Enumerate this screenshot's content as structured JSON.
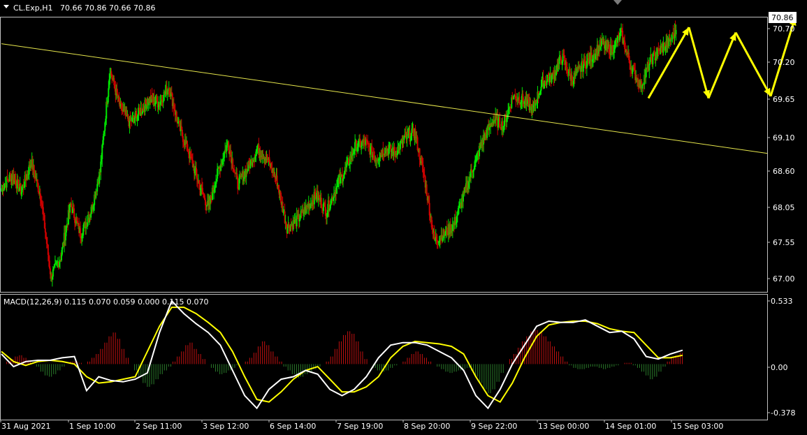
{
  "header": {
    "symbol": "CL.Exp,H1",
    "ohlc": "70.66 70.86 70.66 70.86",
    "current_price": "70.86"
  },
  "macd_header": "MACD(12,26,9) 0.115 0.070 0.059 0.000 0.115 0.070",
  "colors": {
    "background": "#000000",
    "bull": "#00e600",
    "bear": "#d00000",
    "trendline": "#e6e64c",
    "projection": "#ffff00",
    "macd_line": "#ffffff",
    "signal_line": "#ffff00",
    "grid_text": "#ffffff",
    "border": "#c0c0c0"
  },
  "chart_data": [
    {
      "type": "candlestick",
      "title": "CL.Exp,H1",
      "y_ticks": [
        "70.70",
        "70.20",
        "69.65",
        "69.10",
        "68.60",
        "68.05",
        "67.55",
        "67.00"
      ],
      "x_ticks": [
        "31 Aug 2021",
        "1 Sep 10:00",
        "2 Sep 11:00",
        "3 Sep 12:00",
        "6 Sep 14:00",
        "7 Sep 19:00",
        "8 Sep 20:00",
        "9 Sep 22:00",
        "13 Sep 00:00",
        "14 Sep 01:00",
        "15 Sep 03:00"
      ],
      "ylim": [
        66.87,
        71.05
      ],
      "close_path": [
        [
          0,
          68.45
        ],
        [
          1,
          68.65
        ],
        [
          2,
          68.4
        ],
        [
          3,
          68.85
        ],
        [
          4,
          68.3
        ],
        [
          5,
          67.1
        ],
        [
          6,
          67.4
        ],
        [
          7,
          68.2
        ],
        [
          8,
          67.75
        ],
        [
          9,
          68.05
        ],
        [
          10,
          68.7
        ],
        [
          11,
          70.25
        ],
        [
          12,
          69.7
        ],
        [
          13,
          69.45
        ],
        [
          14,
          69.6
        ],
        [
          15,
          69.8
        ],
        [
          16,
          69.75
        ],
        [
          17,
          70.0
        ],
        [
          18,
          69.4
        ],
        [
          19,
          69.0
        ],
        [
          20,
          68.55
        ],
        [
          21,
          68.15
        ],
        [
          22,
          68.7
        ],
        [
          23,
          69.15
        ],
        [
          24,
          68.5
        ],
        [
          25,
          68.75
        ],
        [
          26,
          69.05
        ],
        [
          27,
          68.9
        ],
        [
          28,
          68.55
        ],
        [
          29,
          67.85
        ],
        [
          30,
          67.95
        ],
        [
          31,
          68.15
        ],
        [
          32,
          68.35
        ],
        [
          33,
          68.1
        ],
        [
          34,
          68.45
        ],
        [
          35,
          68.75
        ],
        [
          36,
          69.1
        ],
        [
          37,
          69.15
        ],
        [
          38,
          68.9
        ],
        [
          39,
          69.05
        ],
        [
          40,
          69.0
        ],
        [
          41,
          69.2
        ],
        [
          42,
          69.3
        ],
        [
          43,
          68.6
        ],
        [
          44,
          67.65
        ],
        [
          45,
          67.75
        ],
        [
          46,
          67.9
        ],
        [
          47,
          68.35
        ],
        [
          48,
          68.8
        ],
        [
          49,
          69.2
        ],
        [
          50,
          69.5
        ],
        [
          51,
          69.4
        ],
        [
          52,
          69.85
        ],
        [
          53,
          69.8
        ],
        [
          54,
          69.65
        ],
        [
          55,
          70.05
        ],
        [
          56,
          70.15
        ],
        [
          57,
          70.45
        ],
        [
          58,
          70.1
        ],
        [
          59,
          70.3
        ],
        [
          60,
          70.45
        ],
        [
          61,
          70.65
        ],
        [
          62,
          70.55
        ],
        [
          63,
          70.8
        ],
        [
          64,
          70.3
        ],
        [
          65,
          70.0
        ],
        [
          66,
          70.4
        ],
        [
          67,
          70.55
        ],
        [
          68,
          70.7
        ],
        [
          69,
          70.86
        ]
      ],
      "trendline": [
        [
          0,
          70.65
        ],
        [
          73,
          68.98
        ]
      ],
      "projection": [
        [
          63,
          69.82
        ],
        [
          64,
          70.9
        ],
        [
          65,
          69.82
        ],
        [
          66,
          70.82
        ],
        [
          67,
          69.85
        ],
        [
          68,
          71.05
        ]
      ]
    },
    {
      "type": "macd",
      "title": "MACD(12,26,9)",
      "params": [
        12,
        26,
        9
      ],
      "values": {
        "macd": 0.115,
        "signal": 0.07
      },
      "y_ticks": [
        "0.533",
        "0.00",
        "-0.378"
      ],
      "ylim": [
        -0.44,
        0.55
      ],
      "macd_line": [
        [
          0,
          0.08
        ],
        [
          1,
          -0.02
        ],
        [
          2,
          0.02
        ],
        [
          3,
          0.03
        ],
        [
          4,
          0.03
        ],
        [
          5,
          0.05
        ],
        [
          6,
          0.06
        ],
        [
          7,
          -0.21
        ],
        [
          8,
          -0.1
        ],
        [
          9,
          -0.13
        ],
        [
          10,
          -0.14
        ],
        [
          11,
          -0.12
        ],
        [
          12,
          -0.07
        ],
        [
          13,
          0.25
        ],
        [
          14,
          0.5
        ],
        [
          15,
          0.4
        ],
        [
          16,
          0.32
        ],
        [
          17,
          0.25
        ],
        [
          18,
          0.15
        ],
        [
          19,
          -0.05
        ],
        [
          20,
          -0.25
        ],
        [
          21,
          -0.35
        ],
        [
          22,
          -0.2
        ],
        [
          23,
          -0.12
        ],
        [
          24,
          -0.1
        ],
        [
          25,
          -0.05
        ],
        [
          26,
          -0.08
        ],
        [
          27,
          -0.2
        ],
        [
          28,
          -0.25
        ],
        [
          29,
          -0.2
        ],
        [
          30,
          -0.1
        ],
        [
          31,
          0.05
        ],
        [
          32,
          0.15
        ],
        [
          33,
          0.17
        ],
        [
          34,
          0.17
        ],
        [
          35,
          0.15
        ],
        [
          36,
          0.1
        ],
        [
          37,
          0.05
        ],
        [
          38,
          -0.05
        ],
        [
          39,
          -0.25
        ],
        [
          40,
          -0.35
        ],
        [
          41,
          -0.2
        ],
        [
          42,
          0.0
        ],
        [
          43,
          0.15
        ],
        [
          44,
          0.3
        ],
        [
          45,
          0.34
        ],
        [
          46,
          0.33
        ],
        [
          47,
          0.33
        ],
        [
          48,
          0.35
        ],
        [
          49,
          0.3
        ],
        [
          50,
          0.25
        ],
        [
          51,
          0.26
        ],
        [
          52,
          0.2
        ],
        [
          53,
          0.06
        ],
        [
          54,
          0.04
        ],
        [
          55,
          0.08
        ],
        [
          56,
          0.11
        ]
      ],
      "signal_line": [
        [
          0,
          0.1
        ],
        [
          1,
          0.02
        ],
        [
          2,
          -0.01
        ],
        [
          3,
          0.02
        ],
        [
          4,
          0.03
        ],
        [
          5,
          0.02
        ],
        [
          6,
          0.0
        ],
        [
          7,
          -0.1
        ],
        [
          8,
          -0.15
        ],
        [
          9,
          -0.14
        ],
        [
          10,
          -0.12
        ],
        [
          11,
          -0.1
        ],
        [
          12,
          0.1
        ],
        [
          13,
          0.3
        ],
        [
          14,
          0.45
        ],
        [
          15,
          0.45
        ],
        [
          16,
          0.4
        ],
        [
          17,
          0.33
        ],
        [
          18,
          0.25
        ],
        [
          19,
          0.1
        ],
        [
          20,
          -0.1
        ],
        [
          21,
          -0.28
        ],
        [
          22,
          -0.3
        ],
        [
          23,
          -0.22
        ],
        [
          24,
          -0.12
        ],
        [
          25,
          -0.05
        ],
        [
          26,
          -0.02
        ],
        [
          27,
          -0.12
        ],
        [
          28,
          -0.22
        ],
        [
          29,
          -0.22
        ],
        [
          30,
          -0.18
        ],
        [
          31,
          -0.1
        ],
        [
          32,
          0.05
        ],
        [
          33,
          0.14
        ],
        [
          34,
          0.18
        ],
        [
          35,
          0.17
        ],
        [
          36,
          0.16
        ],
        [
          37,
          0.14
        ],
        [
          38,
          0.08
        ],
        [
          39,
          -0.1
        ],
        [
          40,
          -0.25
        ],
        [
          41,
          -0.3
        ],
        [
          42,
          -0.15
        ],
        [
          43,
          0.05
        ],
        [
          44,
          0.22
        ],
        [
          45,
          0.31
        ],
        [
          46,
          0.33
        ],
        [
          47,
          0.34
        ],
        [
          48,
          0.34
        ],
        [
          49,
          0.32
        ],
        [
          50,
          0.28
        ],
        [
          51,
          0.26
        ],
        [
          52,
          0.25
        ],
        [
          53,
          0.15
        ],
        [
          54,
          0.05
        ],
        [
          55,
          0.05
        ],
        [
          56,
          0.07
        ]
      ],
      "histogram": [
        0.0,
        0.02,
        0.04,
        0.06,
        0.07,
        0.05,
        0.03,
        0.0,
        -0.02,
        -0.06,
        -0.09,
        -0.1,
        -0.08,
        -0.05,
        -0.02,
        0.0,
        0.02,
        0.02,
        0.01,
        0.0,
        0.02,
        0.05,
        0.08,
        0.12,
        0.17,
        0.22,
        0.25,
        0.2,
        0.12,
        0.05,
        0.0,
        -0.05,
        -0.1,
        -0.15,
        -0.18,
        -0.16,
        -0.12,
        -0.08,
        -0.05,
        -0.02,
        0.02,
        0.06,
        0.1,
        0.15,
        0.17,
        0.12,
        0.08,
        0.04,
        0.0,
        -0.03,
        -0.06,
        -0.08,
        -0.07,
        -0.05,
        -0.03,
        -0.01,
        0.0,
        0.02,
        0.05,
        0.09,
        0.14,
        0.18,
        0.15,
        0.1,
        0.06,
        0.02,
        -0.02,
        -0.05,
        -0.08,
        -0.11,
        -0.1,
        -0.08,
        -0.06,
        -0.04,
        -0.02,
        0.0,
        0.02,
        0.06,
        0.12,
        0.18,
        0.23,
        0.26,
        0.24,
        0.18,
        0.1,
        0.04,
        0.0,
        -0.03,
        -0.05,
        -0.06,
        -0.05,
        -0.03,
        -0.01,
        0.0,
        0.02,
        0.05,
        0.08,
        0.1,
        0.08,
        0.05,
        0.02,
        0.0,
        -0.02,
        -0.04,
        -0.06,
        -0.07,
        -0.06,
        -0.05,
        -0.04,
        -0.03,
        -0.05,
        -0.1,
        -0.15,
        -0.2,
        -0.23,
        -0.2,
        -0.14,
        -0.07,
        0.0,
        0.04,
        0.08,
        0.13,
        0.18,
        0.22,
        0.26,
        0.27,
        0.25,
        0.22,
        0.18,
        0.14,
        0.1,
        0.06,
        0.02,
        -0.01,
        -0.03,
        -0.04,
        -0.04,
        -0.03,
        -0.02,
        -0.02,
        -0.03,
        -0.04,
        -0.03,
        -0.02,
        -0.01,
        0.0,
        0.01,
        0.01,
        -0.01,
        -0.03,
        -0.06,
        -0.09,
        -0.12,
        -0.1,
        -0.06,
        -0.02,
        0.02,
        0.05,
        0.07,
        0.09
      ]
    }
  ]
}
